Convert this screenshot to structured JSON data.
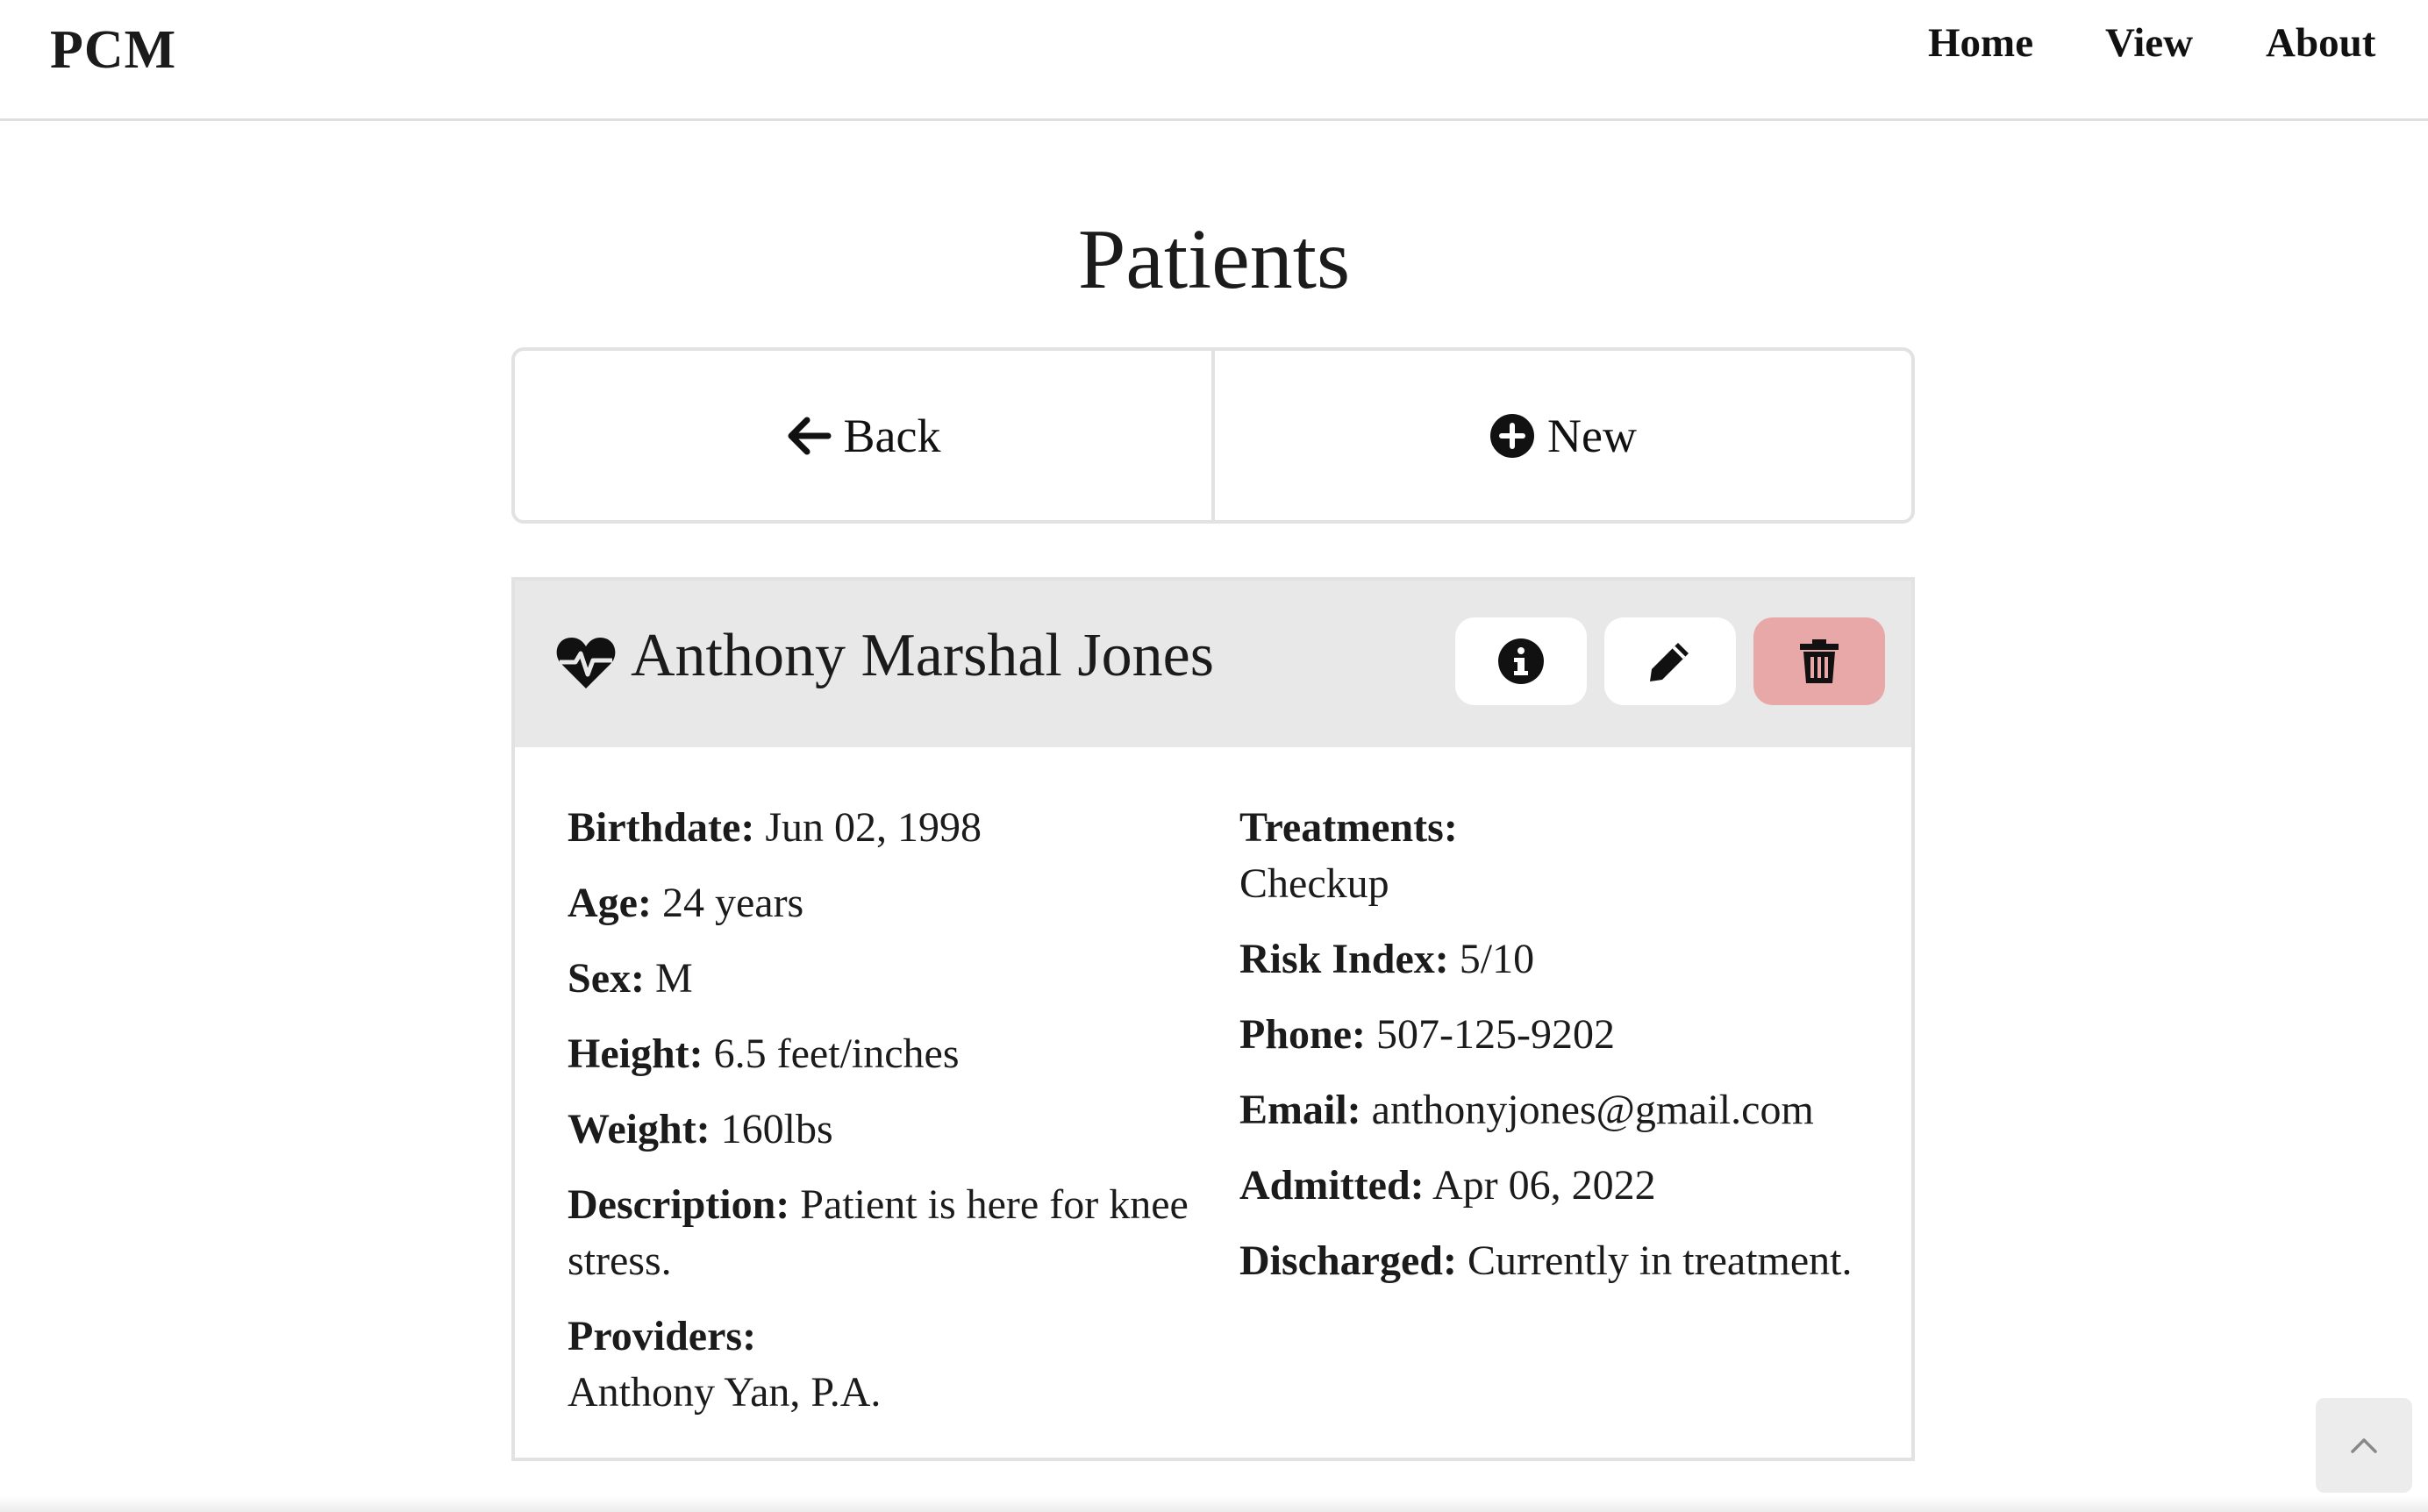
{
  "nav": {
    "brand": "PCM",
    "links": [
      "Home",
      "View",
      "About"
    ]
  },
  "page": {
    "title": "Patients"
  },
  "actions": {
    "back": "Back",
    "new": "New"
  },
  "patient": {
    "name": "Anthony Marshal Jones",
    "left": [
      {
        "label": "Birthdate:",
        "value": "Jun 02, 1998"
      },
      {
        "label": "Age:",
        "value": "24 years"
      },
      {
        "label": "Sex:",
        "value": "M"
      },
      {
        "label": "Height:",
        "value": "6.5 feet/inches"
      },
      {
        "label": "Weight:",
        "value": "160lbs"
      },
      {
        "label": "Description:",
        "value": "Patient is here for knee stress."
      },
      {
        "label": "Providers:",
        "value": "Anthony Yan, P.A."
      }
    ],
    "right": [
      {
        "label": "Treatments:",
        "value": "Checkup"
      },
      {
        "label": "Risk Index:",
        "value": "5/10"
      },
      {
        "label": "Phone:",
        "value": "507-125-9202"
      },
      {
        "label": "Email:",
        "value": "anthonyjones@gmail.com"
      },
      {
        "label": "Admitted:",
        "value": "Apr 06, 2022"
      },
      {
        "label": "Discharged:",
        "value": "Currently in treatment."
      }
    ]
  },
  "icons": {
    "back": "arrow-left-icon",
    "new": "plus-circle-icon",
    "heart": "heart-pulse-icon",
    "info": "info-circle-icon",
    "edit": "pencil-icon",
    "delete": "trash-icon",
    "scroll_top": "chevron-up-icon"
  },
  "colors": {
    "delete_button": "#e9a8a8",
    "card_header": "#e8e8e8"
  }
}
